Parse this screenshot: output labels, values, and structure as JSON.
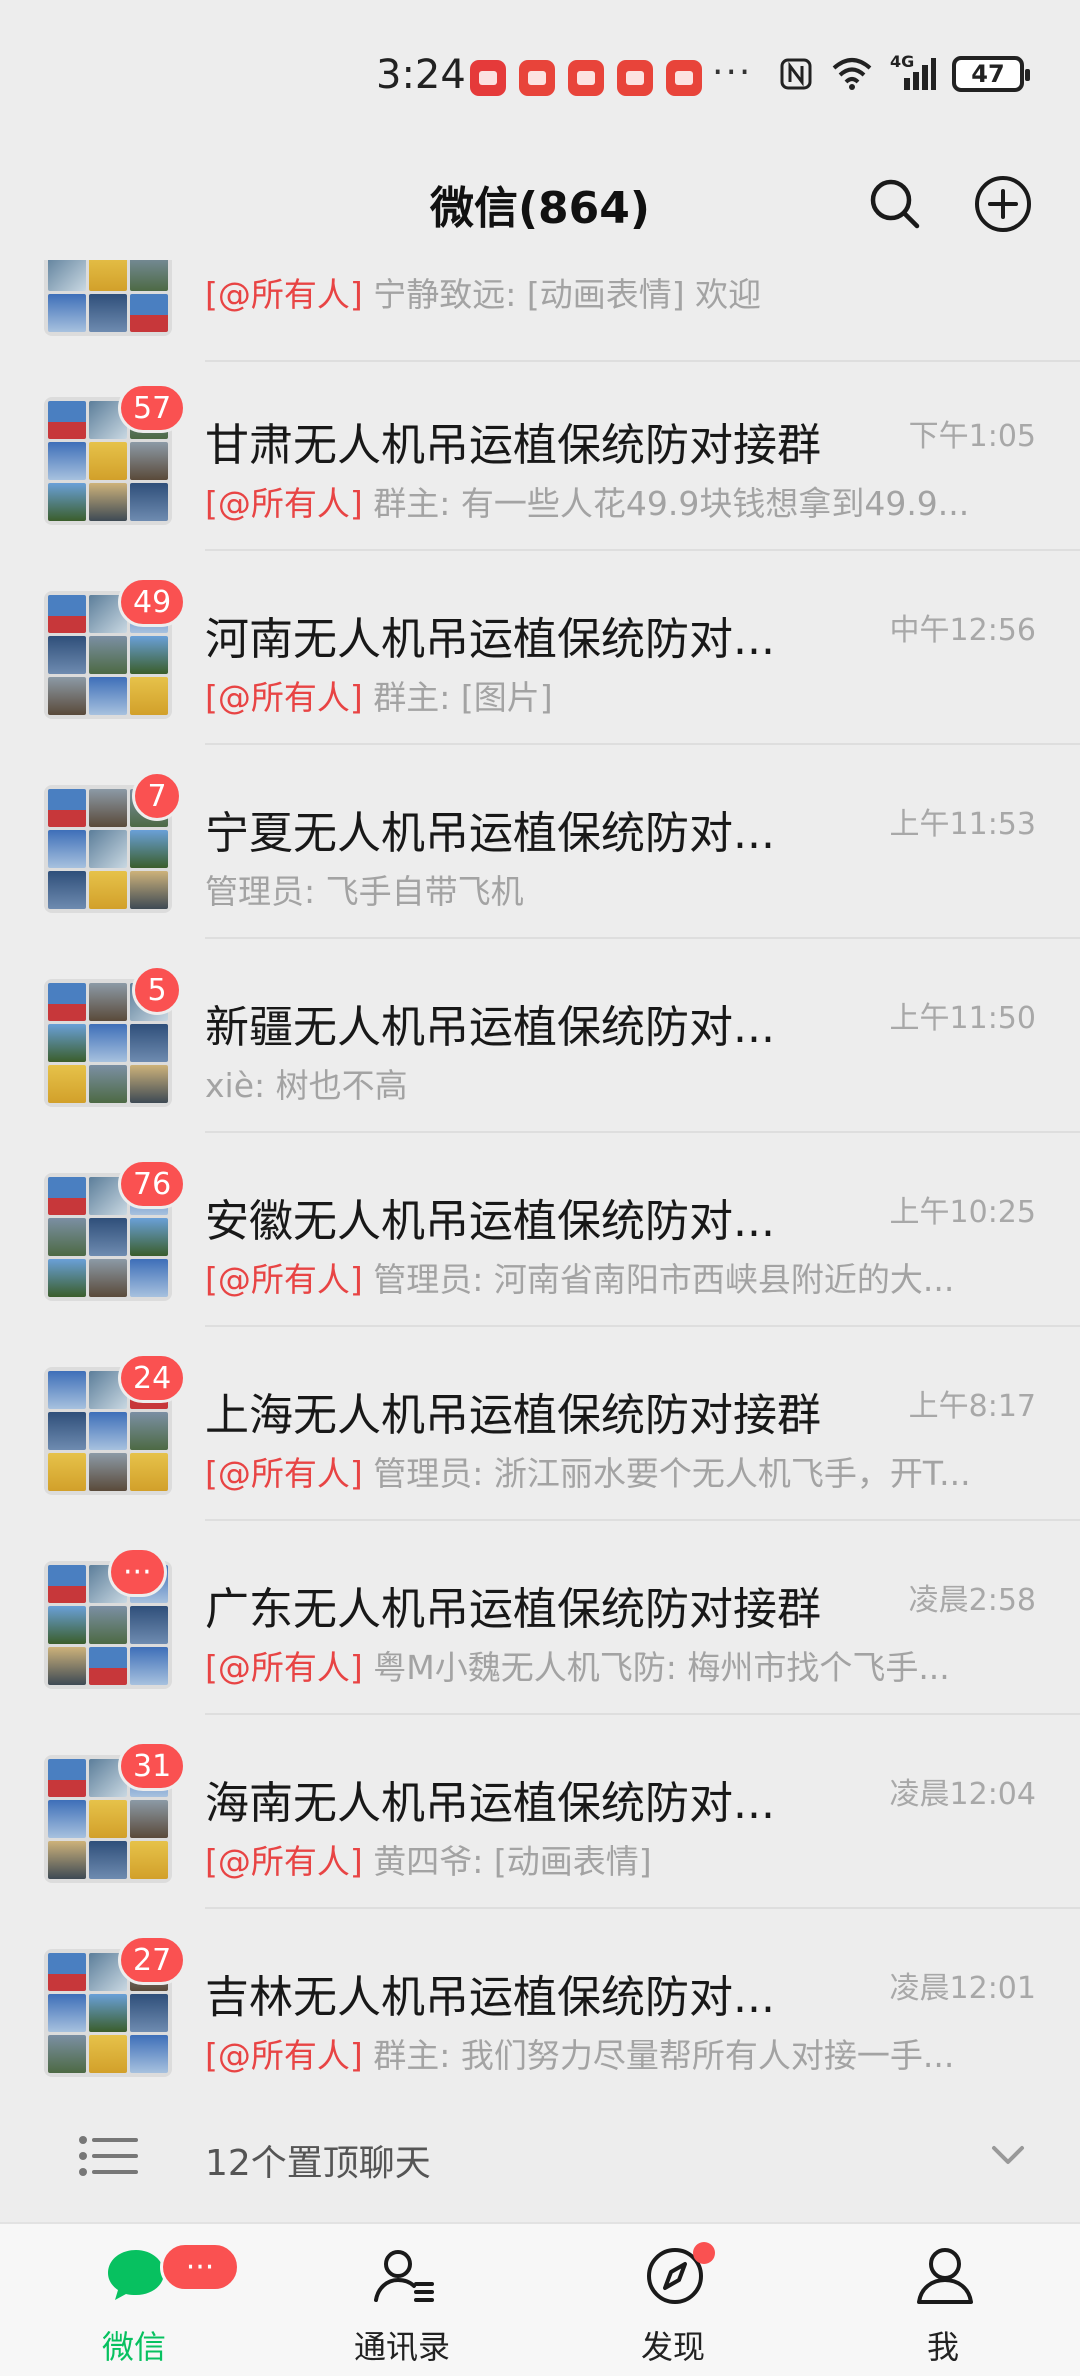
{
  "status_bar": {
    "time": "3:24",
    "more": "···",
    "network": "4G",
    "battery": "47"
  },
  "header": {
    "title": "微信(864)"
  },
  "chats": [
    {
      "avatar_icon": "group-avatar-icon",
      "name": "",
      "time": "",
      "mention": "[@所有人]",
      "message": " 宁静致远: [动画表情] 欢迎",
      "badge": ""
    },
    {
      "avatar_icon": "group-avatar-icon",
      "name": "甘肃无人机吊运植保统防对接群",
      "time": "下午1:05",
      "mention": "[@所有人]",
      "message": " 群主: 有一些人花49.9块钱想拿到49.9...",
      "badge": "57"
    },
    {
      "avatar_icon": "group-avatar-icon",
      "name": "河南无人机吊运植保统防对...",
      "time": "中午12:56",
      "mention": "[@所有人]",
      "message": " 群主: [图片]",
      "badge": "49"
    },
    {
      "avatar_icon": "group-avatar-icon",
      "name": "宁夏无人机吊运植保统防对...",
      "time": "上午11:53",
      "mention": "",
      "message": "管理员: 飞手自带飞机",
      "badge": "7"
    },
    {
      "avatar_icon": "group-avatar-icon",
      "name": "新疆无人机吊运植保统防对...",
      "time": "上午11:50",
      "mention": "",
      "message": "xiè: 树也不高",
      "badge": "5"
    },
    {
      "avatar_icon": "group-avatar-icon",
      "name": "安徽无人机吊运植保统防对...",
      "time": "上午10:25",
      "mention": "[@所有人]",
      "message": " 管理员: 河南省南阳市西峡县附近的大...",
      "badge": "76"
    },
    {
      "avatar_icon": "group-avatar-icon",
      "name": "上海无人机吊运植保统防对接群",
      "time": "上午8:17",
      "mention": "[@所有人]",
      "message": " 管理员: 浙江丽水要个无人机飞手，开T...",
      "badge": "24"
    },
    {
      "avatar_icon": "group-avatar-icon",
      "name": "广东无人机吊运植保统防对接群",
      "time": "凌晨2:58",
      "mention": "[@所有人]",
      "message": " 粤M小魏无人机飞防: 梅州市找个飞手...",
      "badge": "···"
    },
    {
      "avatar_icon": "group-avatar-icon",
      "name": "海南无人机吊运植保统防对...",
      "time": "凌晨12:04",
      "mention": "[@所有人]",
      "message": " 黄四爷: [动画表情]",
      "badge": "31"
    },
    {
      "avatar_icon": "group-avatar-icon",
      "name": "吉林无人机吊运植保统防对...",
      "time": "凌晨12:01",
      "mention": "[@所有人]",
      "message": " 群主: 我们努力尽量帮所有人对接一手...",
      "badge": "27"
    }
  ],
  "pinned": {
    "label": "12个置顶聊天"
  },
  "tabs": [
    {
      "label": "微信",
      "icon": "chat-bubble-icon",
      "badge": "···",
      "active": true
    },
    {
      "label": "通讯录",
      "icon": "contacts-icon",
      "badge": "",
      "active": false
    },
    {
      "label": "发现",
      "icon": "compass-icon",
      "badge": "dot",
      "active": false
    },
    {
      "label": "我",
      "icon": "person-icon",
      "badge": "",
      "active": false
    }
  ],
  "colors": {
    "accent_green": "#07c160",
    "badge_red": "#fa5151",
    "mention_red": "#e84444",
    "background": "#ededed"
  }
}
